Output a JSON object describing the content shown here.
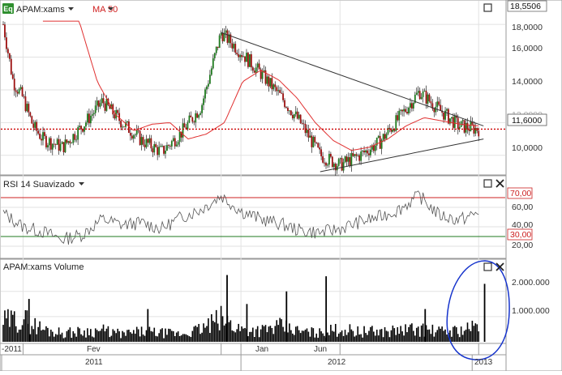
{
  "colors": {
    "candle_up": "#1e7a1e",
    "candle_down": "#9c1010",
    "ma_line": "#e03030",
    "rsi_line": "#555555",
    "level_line": "#cc0000",
    "rsi_upper": "#cc2020",
    "rsi_lower": "#1f7a1f",
    "annotation": "#1533cc",
    "trendline": "#333333",
    "volume": "#000000",
    "grid": "#e2e2e2"
  },
  "icons": {
    "eq_badge": "eq-badge-icon",
    "dropdown": "chevron-down-icon",
    "maximize": "maximize-icon",
    "close": "close-icon"
  },
  "price_panel": {
    "symbol_badge": "Eq",
    "title": "APAM:xams",
    "ma_label": "MA 50",
    "last_value": "18,5506",
    "level_label": "11,6000",
    "y_ticks": [
      "18,0000",
      "16,0000",
      "14,0000",
      "12,0000",
      "10,0000"
    ]
  },
  "rsi_panel": {
    "title": "RSI 14 Suavizado",
    "upper_label": "70,00",
    "lower_label": "30,00",
    "y_ticks": [
      "60,00",
      "40,00",
      "20,00"
    ]
  },
  "volume_panel": {
    "title": "APAM:xams Volume",
    "y_ticks": [
      "2.000.000",
      "1.000.000"
    ]
  },
  "x_axis": {
    "month_labels": [
      "-2011",
      "Fev",
      "Jan",
      "Jun"
    ],
    "year_labels": [
      "2011",
      "2012",
      "2013"
    ]
  },
  "chart_data": [
    {
      "type": "candlestick",
      "title": "APAM:xams",
      "series": [
        {
          "name": "APAM:xams"
        },
        {
          "name": "MA 50"
        }
      ],
      "ylim": [
        9.0,
        18.6
      ],
      "price_path": [
        [
          "2011-01",
          18.0
        ],
        [
          "2011-01",
          14.5
        ],
        [
          "2011-02",
          13.5
        ],
        [
          "2011-02",
          11.8
        ],
        [
          "2011-03",
          11.0
        ],
        [
          "2011-04",
          10.5
        ],
        [
          "2011-05",
          11.8
        ],
        [
          "2011-06",
          13.3
        ],
        [
          "2011-07",
          12.0
        ],
        [
          "2011-08",
          10.9
        ],
        [
          "2011-09",
          10.2
        ],
        [
          "2011-10",
          11.4
        ],
        [
          "2011-11",
          13.0
        ],
        [
          "2011-12",
          17.5
        ],
        [
          "2012-01",
          16.3
        ],
        [
          "2012-02",
          15.0
        ],
        [
          "2012-03",
          13.6
        ],
        [
          "2012-04",
          12.0
        ],
        [
          "2012-05",
          10.0
        ],
        [
          "2012-06",
          9.4
        ],
        [
          "2012-07",
          10.0
        ],
        [
          "2012-08",
          10.8
        ],
        [
          "2012-09",
          12.3
        ],
        [
          "2012-10",
          13.9
        ],
        [
          "2012-11",
          12.8
        ],
        [
          "2012-12",
          11.8
        ],
        [
          "2013-01",
          11.6
        ]
      ],
      "ma_path": [
        [
          "2011-03",
          18.2
        ],
        [
          "2011-04",
          14.5
        ],
        [
          "2011-05",
          12.5
        ],
        [
          "2011-06",
          11.5
        ],
        [
          "2011-07",
          11.9
        ],
        [
          "2011-08",
          12.0
        ],
        [
          "2011-09",
          11.0
        ],
        [
          "2011-10",
          11.3
        ],
        [
          "2011-11",
          12.0
        ],
        [
          "2011-12",
          14.5
        ],
        [
          "2012-01",
          15.2
        ],
        [
          "2012-02",
          14.6
        ],
        [
          "2012-03",
          13.5
        ],
        [
          "2012-04",
          12.0
        ],
        [
          "2012-05",
          10.9
        ],
        [
          "2012-06",
          10.3
        ],
        [
          "2012-07",
          10.5
        ],
        [
          "2012-08",
          11.0
        ],
        [
          "2012-09",
          11.8
        ],
        [
          "2012-10",
          12.3
        ],
        [
          "2012-11",
          12.1
        ],
        [
          "2012-12",
          11.9
        ],
        [
          "2013-01",
          11.8
        ]
      ],
      "horizontal_level": 11.6,
      "trendlines": [
        {
          "from": [
            "2011-12",
            17.5
          ],
          "to": [
            "2013-01",
            11.8
          ]
        },
        {
          "from": [
            "2012-05",
            9.0
          ],
          "to": [
            "2013-01",
            11.0
          ]
        }
      ]
    },
    {
      "type": "line",
      "title": "RSI 14 Suavizado",
      "ylim": [
        10,
        80
      ],
      "levels": [
        70,
        30
      ],
      "rsi_path": [
        [
          "2011-01",
          54
        ],
        [
          "2011-02",
          40
        ],
        [
          "2011-03",
          35
        ],
        [
          "2011-04",
          27
        ],
        [
          "2011-05",
          32
        ],
        [
          "2011-06",
          48
        ],
        [
          "2011-07",
          42
        ],
        [
          "2011-08",
          44
        ],
        [
          "2011-09",
          38
        ],
        [
          "2011-10",
          50
        ],
        [
          "2011-11",
          58
        ],
        [
          "2011-12",
          72
        ],
        [
          "2012-01",
          56
        ],
        [
          "2012-02",
          48
        ],
        [
          "2012-03",
          43
        ],
        [
          "2012-04",
          36
        ],
        [
          "2012-05",
          34
        ],
        [
          "2012-06",
          38
        ],
        [
          "2012-07",
          45
        ],
        [
          "2012-08",
          50
        ],
        [
          "2012-09",
          58
        ],
        [
          "2012-10",
          72
        ],
        [
          "2012-11",
          52
        ],
        [
          "2012-12",
          47
        ],
        [
          "2013-01",
          54
        ]
      ]
    },
    {
      "type": "bar",
      "title": "APAM:xams Volume",
      "ylim": [
        0,
        2700000
      ],
      "volume_profile": [
        [
          "2011-01",
          800000
        ],
        [
          "2011-02",
          900000
        ],
        [
          "2011-03",
          500000
        ],
        [
          "2011-04",
          350000
        ],
        [
          "2011-05",
          400000
        ],
        [
          "2011-06",
          450000
        ],
        [
          "2011-07",
          300000
        ],
        [
          "2011-08",
          400000
        ],
        [
          "2011-09",
          350000
        ],
        [
          "2011-10",
          300000
        ],
        [
          "2011-11",
          500000
        ],
        [
          "2011-12",
          900000
        ],
        [
          "2012-01",
          500000
        ],
        [
          "2012-02",
          450000
        ],
        [
          "2012-03",
          600000
        ],
        [
          "2012-04",
          400000
        ],
        [
          "2012-05",
          350000
        ],
        [
          "2012-06",
          500000
        ],
        [
          "2012-07",
          400000
        ],
        [
          "2012-08",
          400000
        ],
        [
          "2012-09",
          450000
        ],
        [
          "2012-10",
          500000
        ],
        [
          "2012-11",
          400000
        ],
        [
          "2012-12",
          450000
        ],
        [
          "2013-01",
          600000
        ]
      ],
      "spikes": [
        [
          "2011-02",
          1700000
        ],
        [
          "2011-08",
          1300000
        ],
        [
          "2011-12",
          2650000
        ],
        [
          "2012-01",
          1500000
        ],
        [
          "2012-03",
          2000000
        ],
        [
          "2012-05",
          2600000
        ],
        [
          "2012-10",
          1300000
        ],
        [
          "2013-01",
          2300000
        ]
      ]
    }
  ]
}
